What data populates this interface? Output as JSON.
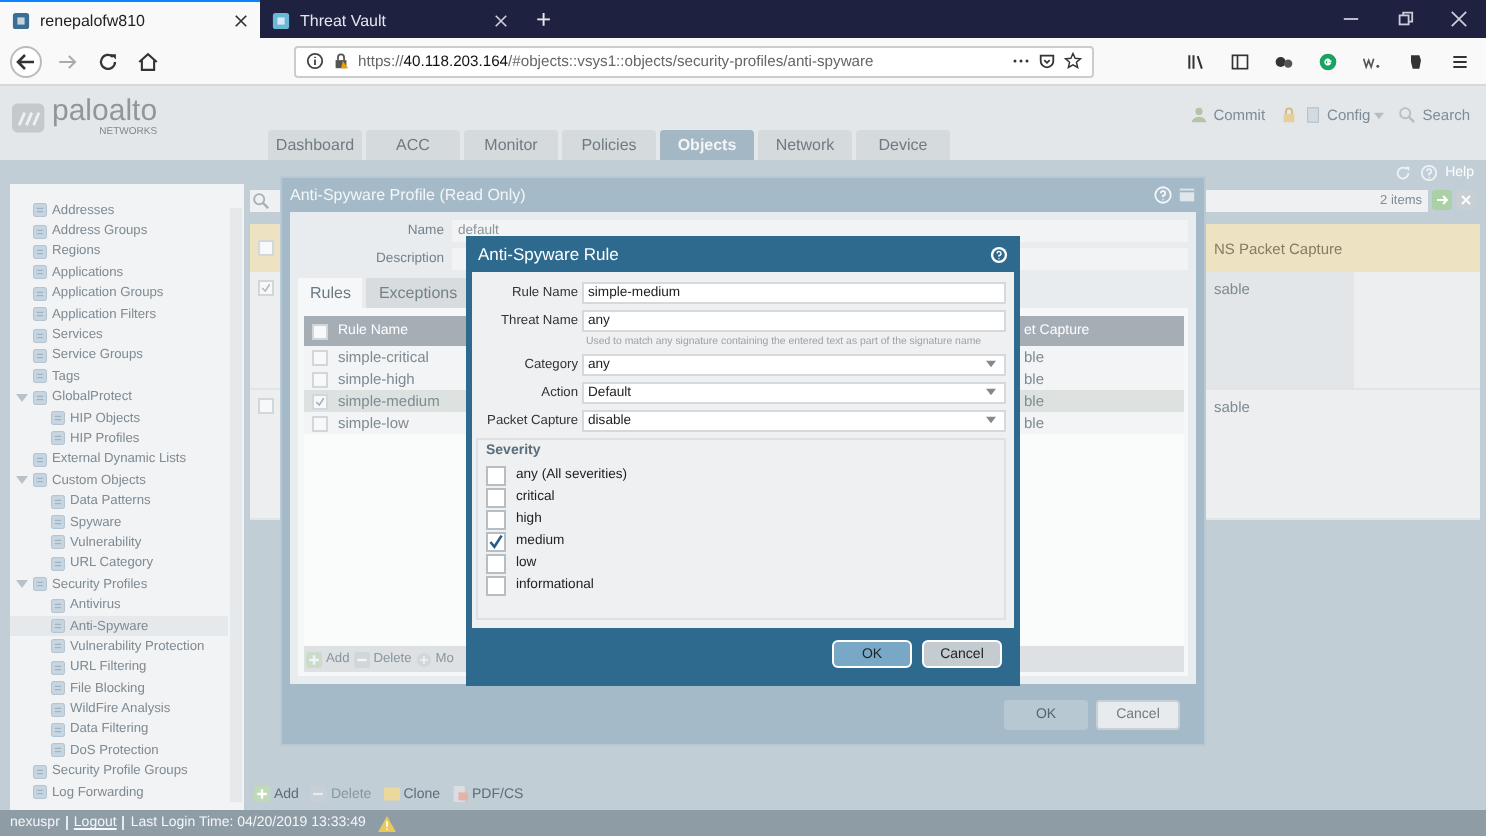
{
  "browser": {
    "tabs": [
      {
        "title": "renepalofw810",
        "selected": true
      },
      {
        "title": "Threat Vault",
        "selected": false
      }
    ],
    "new_tab": "+",
    "url": "https://**40.118.203.164**/#objects::vsys1::objects/security-profiles/anti-spyware"
  },
  "app": {
    "logo": {
      "name": "paloalto",
      "sub": "NETWORKS"
    },
    "tabs": [
      {
        "label": "Dashboard",
        "selected": false
      },
      {
        "label": "ACC",
        "selected": false
      },
      {
        "label": "Monitor",
        "selected": false
      },
      {
        "label": "Policies",
        "selected": false
      },
      {
        "label": "Objects",
        "selected": true
      },
      {
        "label": "Network",
        "selected": false
      },
      {
        "label": "Device",
        "selected": false
      }
    ],
    "commit": "Commit",
    "config": "Config",
    "search": "Search",
    "help": "Help"
  },
  "sidebar": {
    "items": [
      {
        "label": "Addresses",
        "selected": false
      },
      {
        "label": "Address Groups",
        "selected": false
      },
      {
        "label": "Regions",
        "selected": false
      },
      {
        "label": "Applications",
        "selected": false
      },
      {
        "label": "Application Groups",
        "selected": false
      },
      {
        "label": "Application Filters",
        "selected": false
      },
      {
        "label": "Services",
        "selected": false
      },
      {
        "label": "Service Groups",
        "selected": false
      },
      {
        "label": "Tags",
        "selected": false
      },
      {
        "label": "GlobalProtect",
        "selected": false,
        "expanded": true,
        "children": [
          {
            "label": "HIP Objects",
            "selected": false
          },
          {
            "label": "HIP Profiles",
            "selected": false
          }
        ]
      },
      {
        "label": "External Dynamic Lists",
        "selected": false
      },
      {
        "label": "Custom Objects",
        "selected": false,
        "expanded": true,
        "children": [
          {
            "label": "Data Patterns",
            "selected": false
          },
          {
            "label": "Spyware",
            "selected": false
          },
          {
            "label": "Vulnerability",
            "selected": false
          },
          {
            "label": "URL Category",
            "selected": false
          }
        ]
      },
      {
        "label": "Security Profiles",
        "selected": false,
        "expanded": true,
        "children": [
          {
            "label": "Antivirus",
            "selected": false
          },
          {
            "label": "Anti-Spyware",
            "selected": true
          },
          {
            "label": "Vulnerability Protection",
            "selected": false
          },
          {
            "label": "URL Filtering",
            "selected": false
          },
          {
            "label": "File Blocking",
            "selected": false
          },
          {
            "label": "WildFire Analysis",
            "selected": false
          },
          {
            "label": "Data Filtering",
            "selected": false
          },
          {
            "label": "DoS Protection",
            "selected": false
          }
        ]
      },
      {
        "label": "Security Profile Groups",
        "selected": false
      },
      {
        "label": "Log Forwarding",
        "selected": false
      }
    ]
  },
  "main": {
    "count": "2 items",
    "table": {
      "header_checked": false,
      "column_2": "NS Packet Capture",
      "rows": [
        {
          "checked": true,
          "column_2": "sable"
        },
        {
          "checked": false,
          "column_2": "sable"
        }
      ]
    },
    "toolbar": [
      {
        "kind": "add",
        "label": "Add",
        "disabled": false
      },
      {
        "kind": "delete",
        "label": "Delete",
        "disabled": true
      },
      {
        "kind": "clone",
        "label": "Clone",
        "disabled": false
      },
      {
        "kind": "pdf",
        "label": "PDF/CS",
        "disabled": false
      }
    ]
  },
  "status_bar": {
    "user": "nexuspr",
    "logout": "Logout",
    "last_login": "Last Login Time: 04/20/2019 13:33:49"
  },
  "profile_dialog": {
    "title": "Anti-Spyware Profile (Read Only)",
    "name_label": "Name",
    "name_value": "default",
    "description_label": "Description",
    "tabs": [
      {
        "label": "Rules",
        "selected": true
      },
      {
        "label": "Exceptions",
        "selected": false
      }
    ],
    "table": {
      "header_checked": false,
      "column_1": "Rule Name",
      "column_2": "et Capture",
      "rows": [
        {
          "name": "simple-critical",
          "capture": "ble",
          "checked": false,
          "selected": false
        },
        {
          "name": "simple-high",
          "capture": "ble",
          "checked": false,
          "selected": false
        },
        {
          "name": "simple-medium",
          "capture": "ble",
          "checked": true,
          "selected": true
        },
        {
          "name": "simple-low",
          "capture": "ble",
          "checked": false,
          "selected": false
        }
      ]
    },
    "toolbar": [
      {
        "kind": "add",
        "label": "Add",
        "disabled": true
      },
      {
        "kind": "delete",
        "label": "Delete",
        "disabled": true
      },
      {
        "kind": "move",
        "label": "Mo",
        "disabled": true
      }
    ],
    "ok": {
      "label": "OK",
      "disabled": true
    },
    "cancel": "Cancel"
  },
  "rule_dialog": {
    "title": "Anti-Spyware Rule",
    "fields": [
      {
        "label": "Rule Name",
        "value": "simple-medium",
        "kind": "text"
      },
      {
        "label": "Threat Name",
        "value": "any",
        "kind": "text",
        "hint": "Used to match any signature containing the entered text as part of the signature name"
      },
      {
        "label": "Category",
        "value": "any",
        "kind": "select"
      },
      {
        "label": "Action",
        "value": "Default",
        "kind": "select"
      },
      {
        "label": "Packet Capture",
        "value": "disable",
        "kind": "select"
      }
    ],
    "severity_title": "Severity",
    "severities": [
      {
        "label": "any (All severities)",
        "checked": false
      },
      {
        "label": "critical",
        "checked": false
      },
      {
        "label": "high",
        "checked": false
      },
      {
        "label": "medium",
        "checked": true
      },
      {
        "label": "low",
        "checked": false
      },
      {
        "label": "informational",
        "checked": false
      }
    ],
    "ok": "OK",
    "cancel": "Cancel"
  }
}
